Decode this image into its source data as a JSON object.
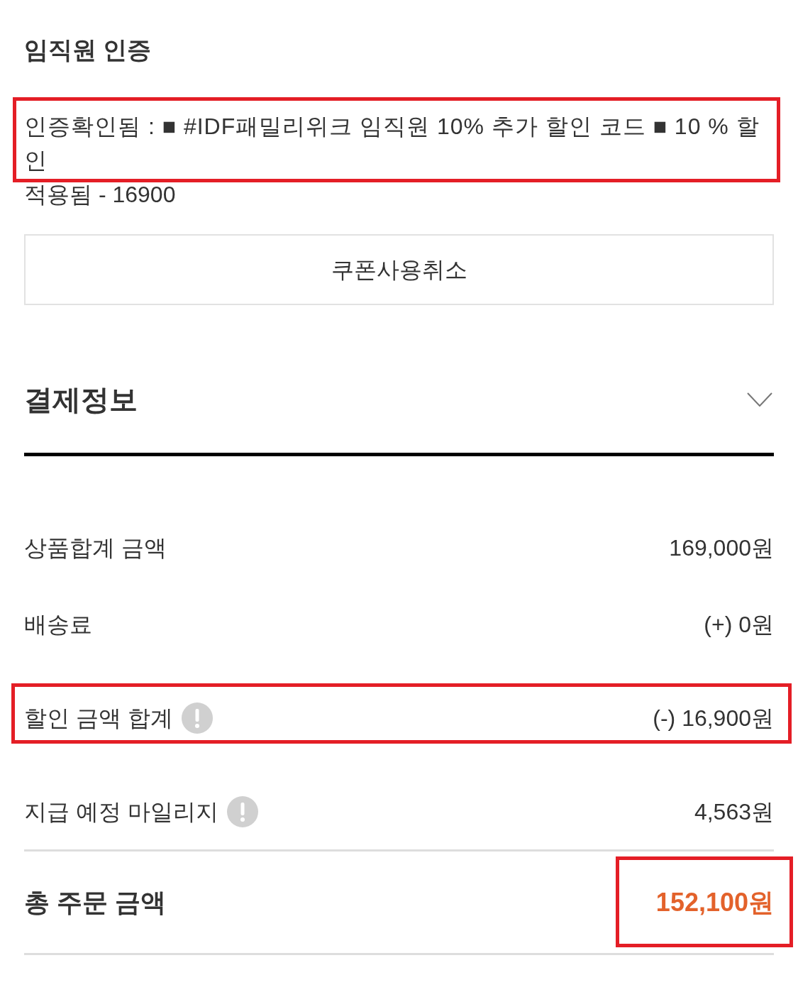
{
  "employee_verification": {
    "title": "임직원 인증",
    "message": "인증확인됨 : ■ #IDF패밀리위크 임직원 10% 추가 할인 코드 ■ 10 % 할인",
    "message_highlighted": true,
    "detail": "적용됨 - 16900",
    "cancel_button": "쿠폰사용취소"
  },
  "payment_info": {
    "title": "결제정보",
    "rows": [
      {
        "label": "상품합계 금액",
        "value": "169,000원",
        "info_icon": false,
        "highlighted": false
      },
      {
        "label": "배송료",
        "value": "(+) 0원",
        "info_icon": false,
        "highlighted": false
      },
      {
        "label": "할인 금액 합계",
        "value": "(-) 16,900원",
        "info_icon": true,
        "highlighted": true
      },
      {
        "label": "지급 예정 마일리지",
        "value": "4,563원",
        "info_icon": true,
        "highlighted": false
      }
    ],
    "total": {
      "label": "총 주문 금액",
      "value": "152,100원",
      "highlighted": true
    }
  }
}
